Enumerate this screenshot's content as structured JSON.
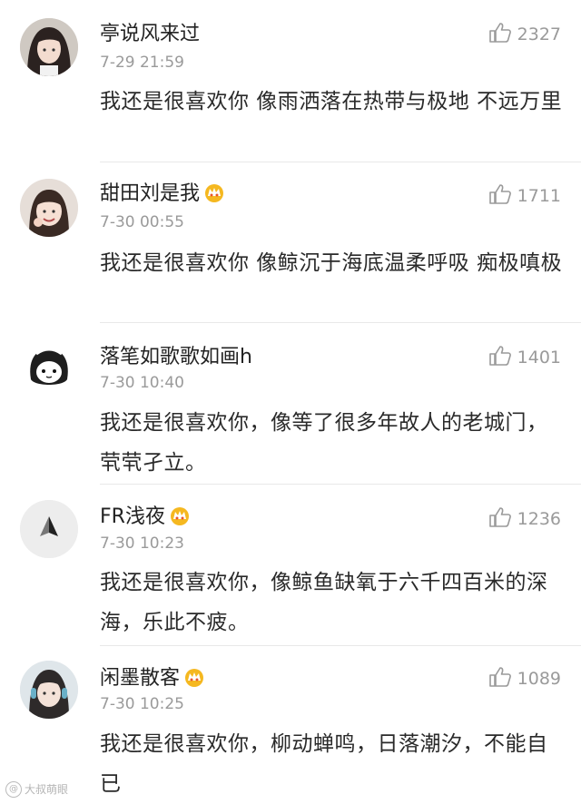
{
  "comments": [
    {
      "username": "亭说风来过",
      "timestamp": "7-29 21:59",
      "likes": "2327",
      "text": "我还是很喜欢你 像雨洒落在热带与极地 不远万里",
      "crown": false,
      "avatar": "avatar-girl-dark-hair-icon"
    },
    {
      "username": "甜田刘是我",
      "timestamp": "7-30 00:55",
      "likes": "1711",
      "text": "我还是很喜欢你 像鲸沉于海底温柔呼吸 痴极嗔极",
      "crown": true,
      "avatar": "avatar-smiling-girl-icon"
    },
    {
      "username": "落笔如歌歌如画h",
      "timestamp": "7-30 10:40",
      "likes": "1401",
      "text": "我还是很喜欢你，像等了很多年故人的老城门，茕茕孑立。",
      "crown": false,
      "avatar": "avatar-cartoon-maid-icon"
    },
    {
      "username": "FR浅夜",
      "timestamp": "7-30 10:23",
      "likes": "1236",
      "text": "我还是很喜欢你，像鲸鱼缺氧于六千四百米的深海，乐此不疲。",
      "crown": true,
      "avatar": "avatar-geometric-logo-icon"
    },
    {
      "username": "闲墨散客",
      "timestamp": "7-30 10:25",
      "likes": "1089",
      "text": "我还是很喜欢你，柳动蝉鸣，日落潮汐，不能自已",
      "crown": true,
      "avatar": "avatar-girl-headphones-icon"
    }
  ],
  "watermark": "大叔萌眼",
  "colors": {
    "secondary_text": "#9a9a9a",
    "divider": "#e8e8e8",
    "crown": "#f5b820"
  }
}
